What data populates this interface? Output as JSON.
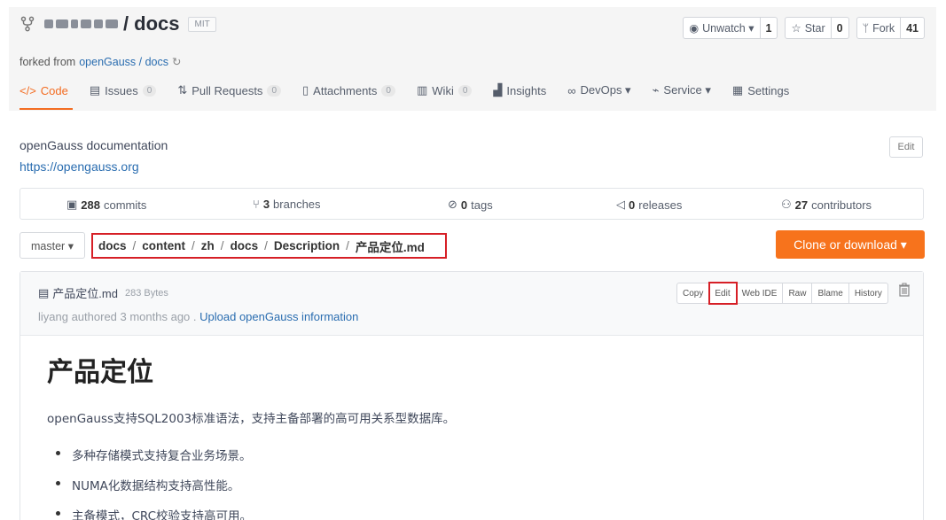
{
  "repo": {
    "name": "docs",
    "slash": "/",
    "license": "MIT",
    "forked_prefix": "forked from",
    "forked_link": "openGauss / docs"
  },
  "actions": [
    {
      "label": "Unwatch ▾",
      "count": "1",
      "icon": "eye-icon"
    },
    {
      "label": "Star",
      "count": "0",
      "icon": "star-icon"
    },
    {
      "label": "Fork",
      "count": "41",
      "icon": "fork-icon"
    }
  ],
  "tabs": [
    {
      "label": "Code",
      "badge": ""
    },
    {
      "label": "Issues",
      "badge": "0"
    },
    {
      "label": "Pull Requests",
      "badge": "0"
    },
    {
      "label": "Attachments",
      "badge": "0"
    },
    {
      "label": "Wiki",
      "badge": "0"
    },
    {
      "label": "Insights",
      "badge": ""
    },
    {
      "label": "DevOps ▾",
      "badge": ""
    },
    {
      "label": "Service ▾",
      "badge": ""
    },
    {
      "label": "Settings",
      "badge": ""
    }
  ],
  "description": "openGauss documentation",
  "homepage": "https://opengauss.org",
  "edit_label": "Edit",
  "stats": {
    "commits_n": "288",
    "commits_l": "commits",
    "branches_n": "3",
    "branches_l": "branches",
    "tags_n": "0",
    "tags_l": "tags",
    "releases_n": "0",
    "releases_l": "releases",
    "contributors_n": "27",
    "contributors_l": "contributors"
  },
  "branch": "master ▾",
  "breadcrumb": [
    "docs",
    "content",
    "zh",
    "docs",
    "Description",
    "产品定位.md"
  ],
  "clone_label": "Clone or download ▾",
  "file": {
    "name": "产品定位.md",
    "size": "283 Bytes",
    "commit_author": "liyang authored 3 months ago .",
    "commit_msg": "Upload openGauss information",
    "tools": [
      "Copy",
      "Edit",
      "Web IDE",
      "Raw",
      "Blame",
      "History"
    ]
  },
  "content": {
    "heading": "产品定位",
    "paragraph": "openGauss支持SQL2003标准语法，支持主备部署的高可用关系型数据库。",
    "bullets": [
      "多种存储模式支持复合业务场景。",
      "NUMA化数据结构支持高性能。",
      "主备模式，CRC校验支持高可用。"
    ]
  },
  "colors": {
    "accent": "#f36c21",
    "clone": "#f7731c",
    "highlight": "#d61f26",
    "link": "#2a6db0"
  }
}
